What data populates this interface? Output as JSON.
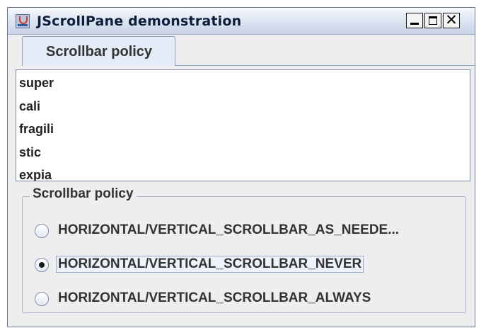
{
  "window": {
    "title": "JScrollPane demonstration",
    "close_glyph": "✕"
  },
  "tabs": [
    {
      "label": "Scrollbar policy",
      "selected": true
    }
  ],
  "list": {
    "items": [
      "super",
      "cali",
      "fragili",
      "stic",
      "expia"
    ]
  },
  "policy_group": {
    "title": "Scrollbar policy",
    "options": [
      {
        "label": "HORIZONTAL/VERTICAL_SCROLLBAR_AS_NEEDE...",
        "selected": false
      },
      {
        "label": "HORIZONTAL/VERTICAL_SCROLLBAR_NEVER",
        "selected": true
      },
      {
        "label": "HORIZONTAL/VERTICAL_SCROLLBAR_ALWAYS",
        "selected": false
      }
    ]
  },
  "colors": {
    "titlebar": "#c9d4e8",
    "window_bg": "#eeeeee",
    "border_accent": "#8ea1c2"
  }
}
